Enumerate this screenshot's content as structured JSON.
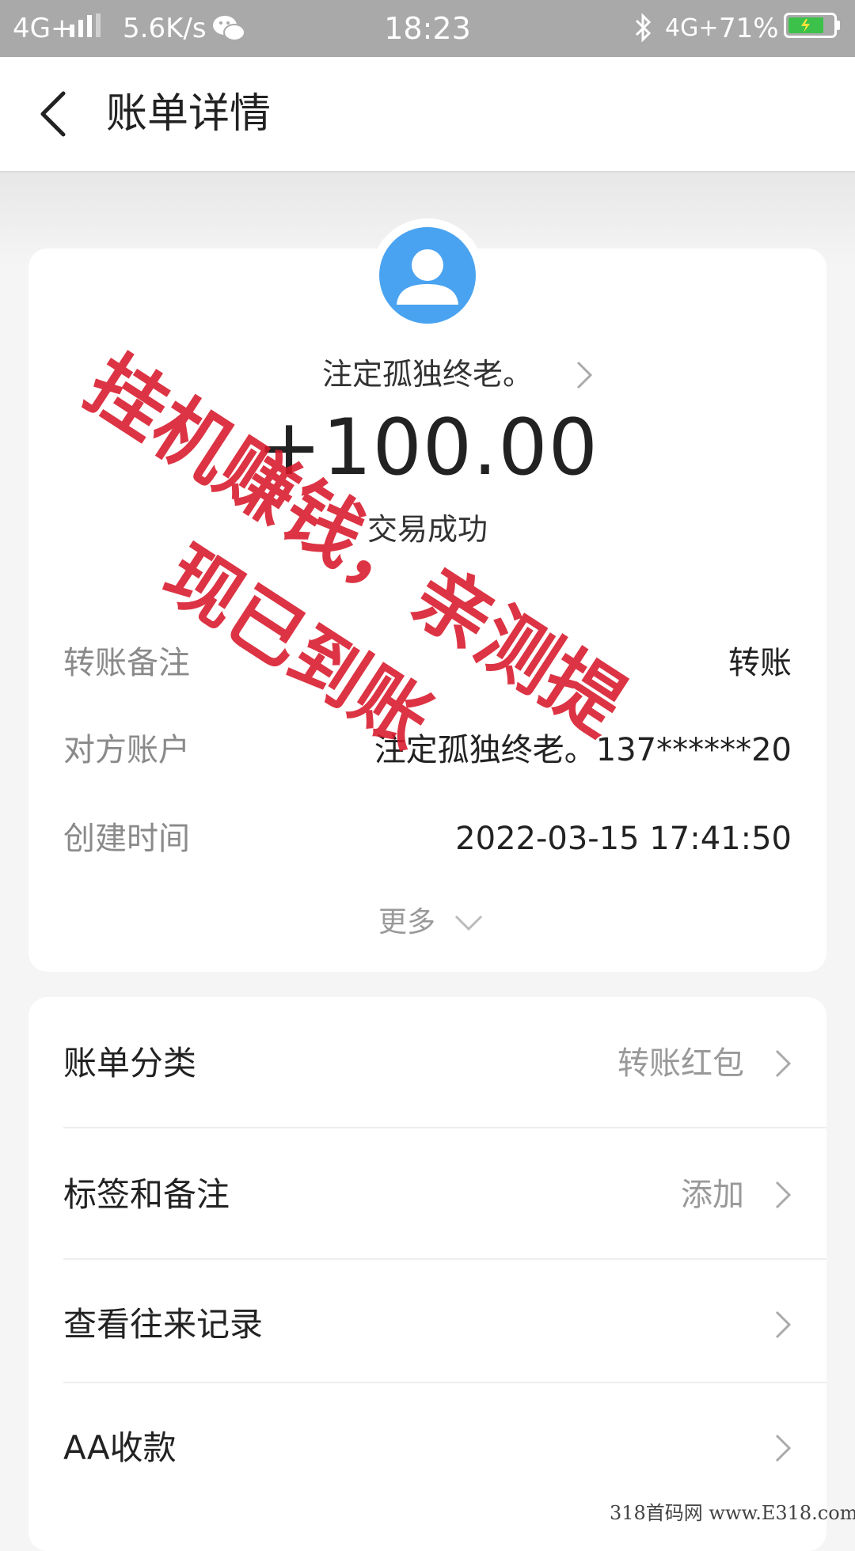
{
  "status_bar": {
    "network": "4G+",
    "speed": "5.6K/s",
    "time": "18:23",
    "network2": "4G+",
    "battery": "71%",
    "icons": [
      "signal-bars-icon",
      "wechat-icon",
      "bluetooth-icon",
      "battery-charging-icon"
    ]
  },
  "header": {
    "title": "账单详情",
    "back_icon": "chevron-left-icon"
  },
  "detail": {
    "counterparty_name": "注定孤独终老。",
    "amount": "+100.00",
    "status": "交易成功",
    "rows": [
      {
        "label": "转账备注",
        "value": "转账"
      },
      {
        "label": "对方账户",
        "value": "注定孤独终老。137******20"
      },
      {
        "label": "创建时间",
        "value": "2022-03-15 17:41:50"
      }
    ],
    "more_label": "更多"
  },
  "menu": {
    "items": [
      {
        "label": "账单分类",
        "value": "转账红包"
      },
      {
        "label": "标签和备注",
        "value": "添加"
      },
      {
        "label": "查看往来记录",
        "value": ""
      },
      {
        "label": "AA收款",
        "value": ""
      }
    ]
  },
  "watermark": {
    "line1": "挂机赚钱，亲测提",
    "line2": "现已到账",
    "site": "318首码网 www.E318.com"
  },
  "colors": {
    "status_bar_bg": "#a9a9a9",
    "avatar_blue": "#4aa3f0",
    "watermark_red": "#d8192b",
    "battery_green": "#3cc24a"
  }
}
